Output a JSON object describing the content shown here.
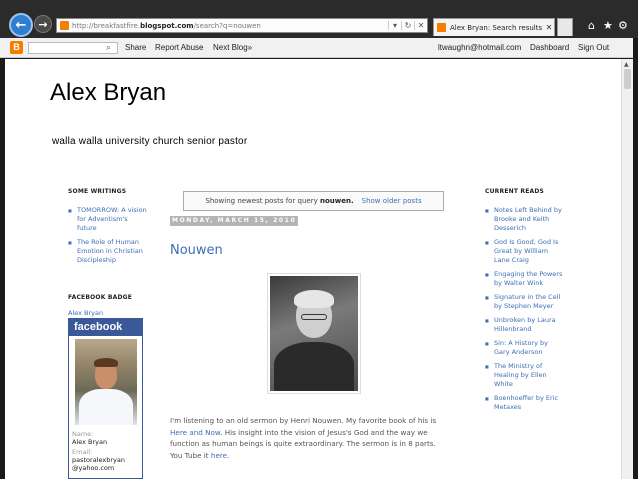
{
  "browser": {
    "url_prefix": "http://breakfastfire.",
    "url_domain": "blogspot.com",
    "url_suffix": "/search?q=nouwen",
    "tab_title": "Alex Bryan: Search results for ...",
    "refresh_glyph": "↻",
    "stop_glyph": "✕",
    "dropdown_glyph": "▾",
    "home_glyph": "⌂",
    "favorites_glyph": "★",
    "tools_glyph": "⚙",
    "back_glyph": "←",
    "forward_glyph": "→",
    "close_tab_glyph": "✕"
  },
  "navbar": {
    "logo": "B",
    "search_glyph": "⌕",
    "share": "Share",
    "report_abuse": "Report Abuse",
    "next_blog": "Next Blog»",
    "email": "ltwaughn@hotmail.com",
    "dashboard": "Dashboard",
    "sign_out": "Sign Out"
  },
  "blog": {
    "title": "Alex Bryan",
    "description": "walla walla university church senior pastor"
  },
  "left_sidebar": {
    "writings_heading": "SOME WRITINGS",
    "writings": [
      "TOMORROW: A vision for Adventism's future",
      "The Role of Human Emotion in Christian Discipleship"
    ],
    "facebook_heading": "FACEBOOK BADGE",
    "facebook_link": "Alex Bryan",
    "facebook_logo": "facebook",
    "name_label": "Name:",
    "name_value": "Alex Bryan",
    "email_label": "Email:",
    "email_value_1": "pastoralexbryan",
    "email_value_2": "@yahoo.com"
  },
  "main": {
    "query_prefix": "Showing newest posts for query",
    "query_term": "nouwen.",
    "older_posts": "Show older posts",
    "date_header": "MONDAY, MARCH 15, 2010",
    "post_title": "Nouwen",
    "body_1": "I'm listening to an old sermon by Henri Nouwen. My favorite book of his is ",
    "body_link_1": "Here and Now",
    "body_2": ". His insight into the vision of Jesus's God and the way we function as human beings is quite extraordinary. The sermon is in 8 parts. You Tube it ",
    "body_link_2": "here",
    "body_3": "."
  },
  "right_sidebar": {
    "heading": "CURRENT READS",
    "reads": [
      "Notes Left Behind by Brooke and Keith Desserich",
      "God Is Good, God Is Great by William Lane Craig",
      "Engaging the Powers by Walter Wink",
      "Signature in the Cell by Stephen Meyer",
      "Unbroken by Laura Hillenbrand",
      "Sin: A History by Gary Anderson",
      "The Ministry of Healing by Ellen White",
      "Boenhoeffer by Eric Metaxes"
    ]
  },
  "colors": {
    "link_blue": "#3d6fb5",
    "facebook_blue": "#3b5998",
    "blogger_orange": "#f57d00",
    "back_button_blue": "#2f7fd1"
  }
}
